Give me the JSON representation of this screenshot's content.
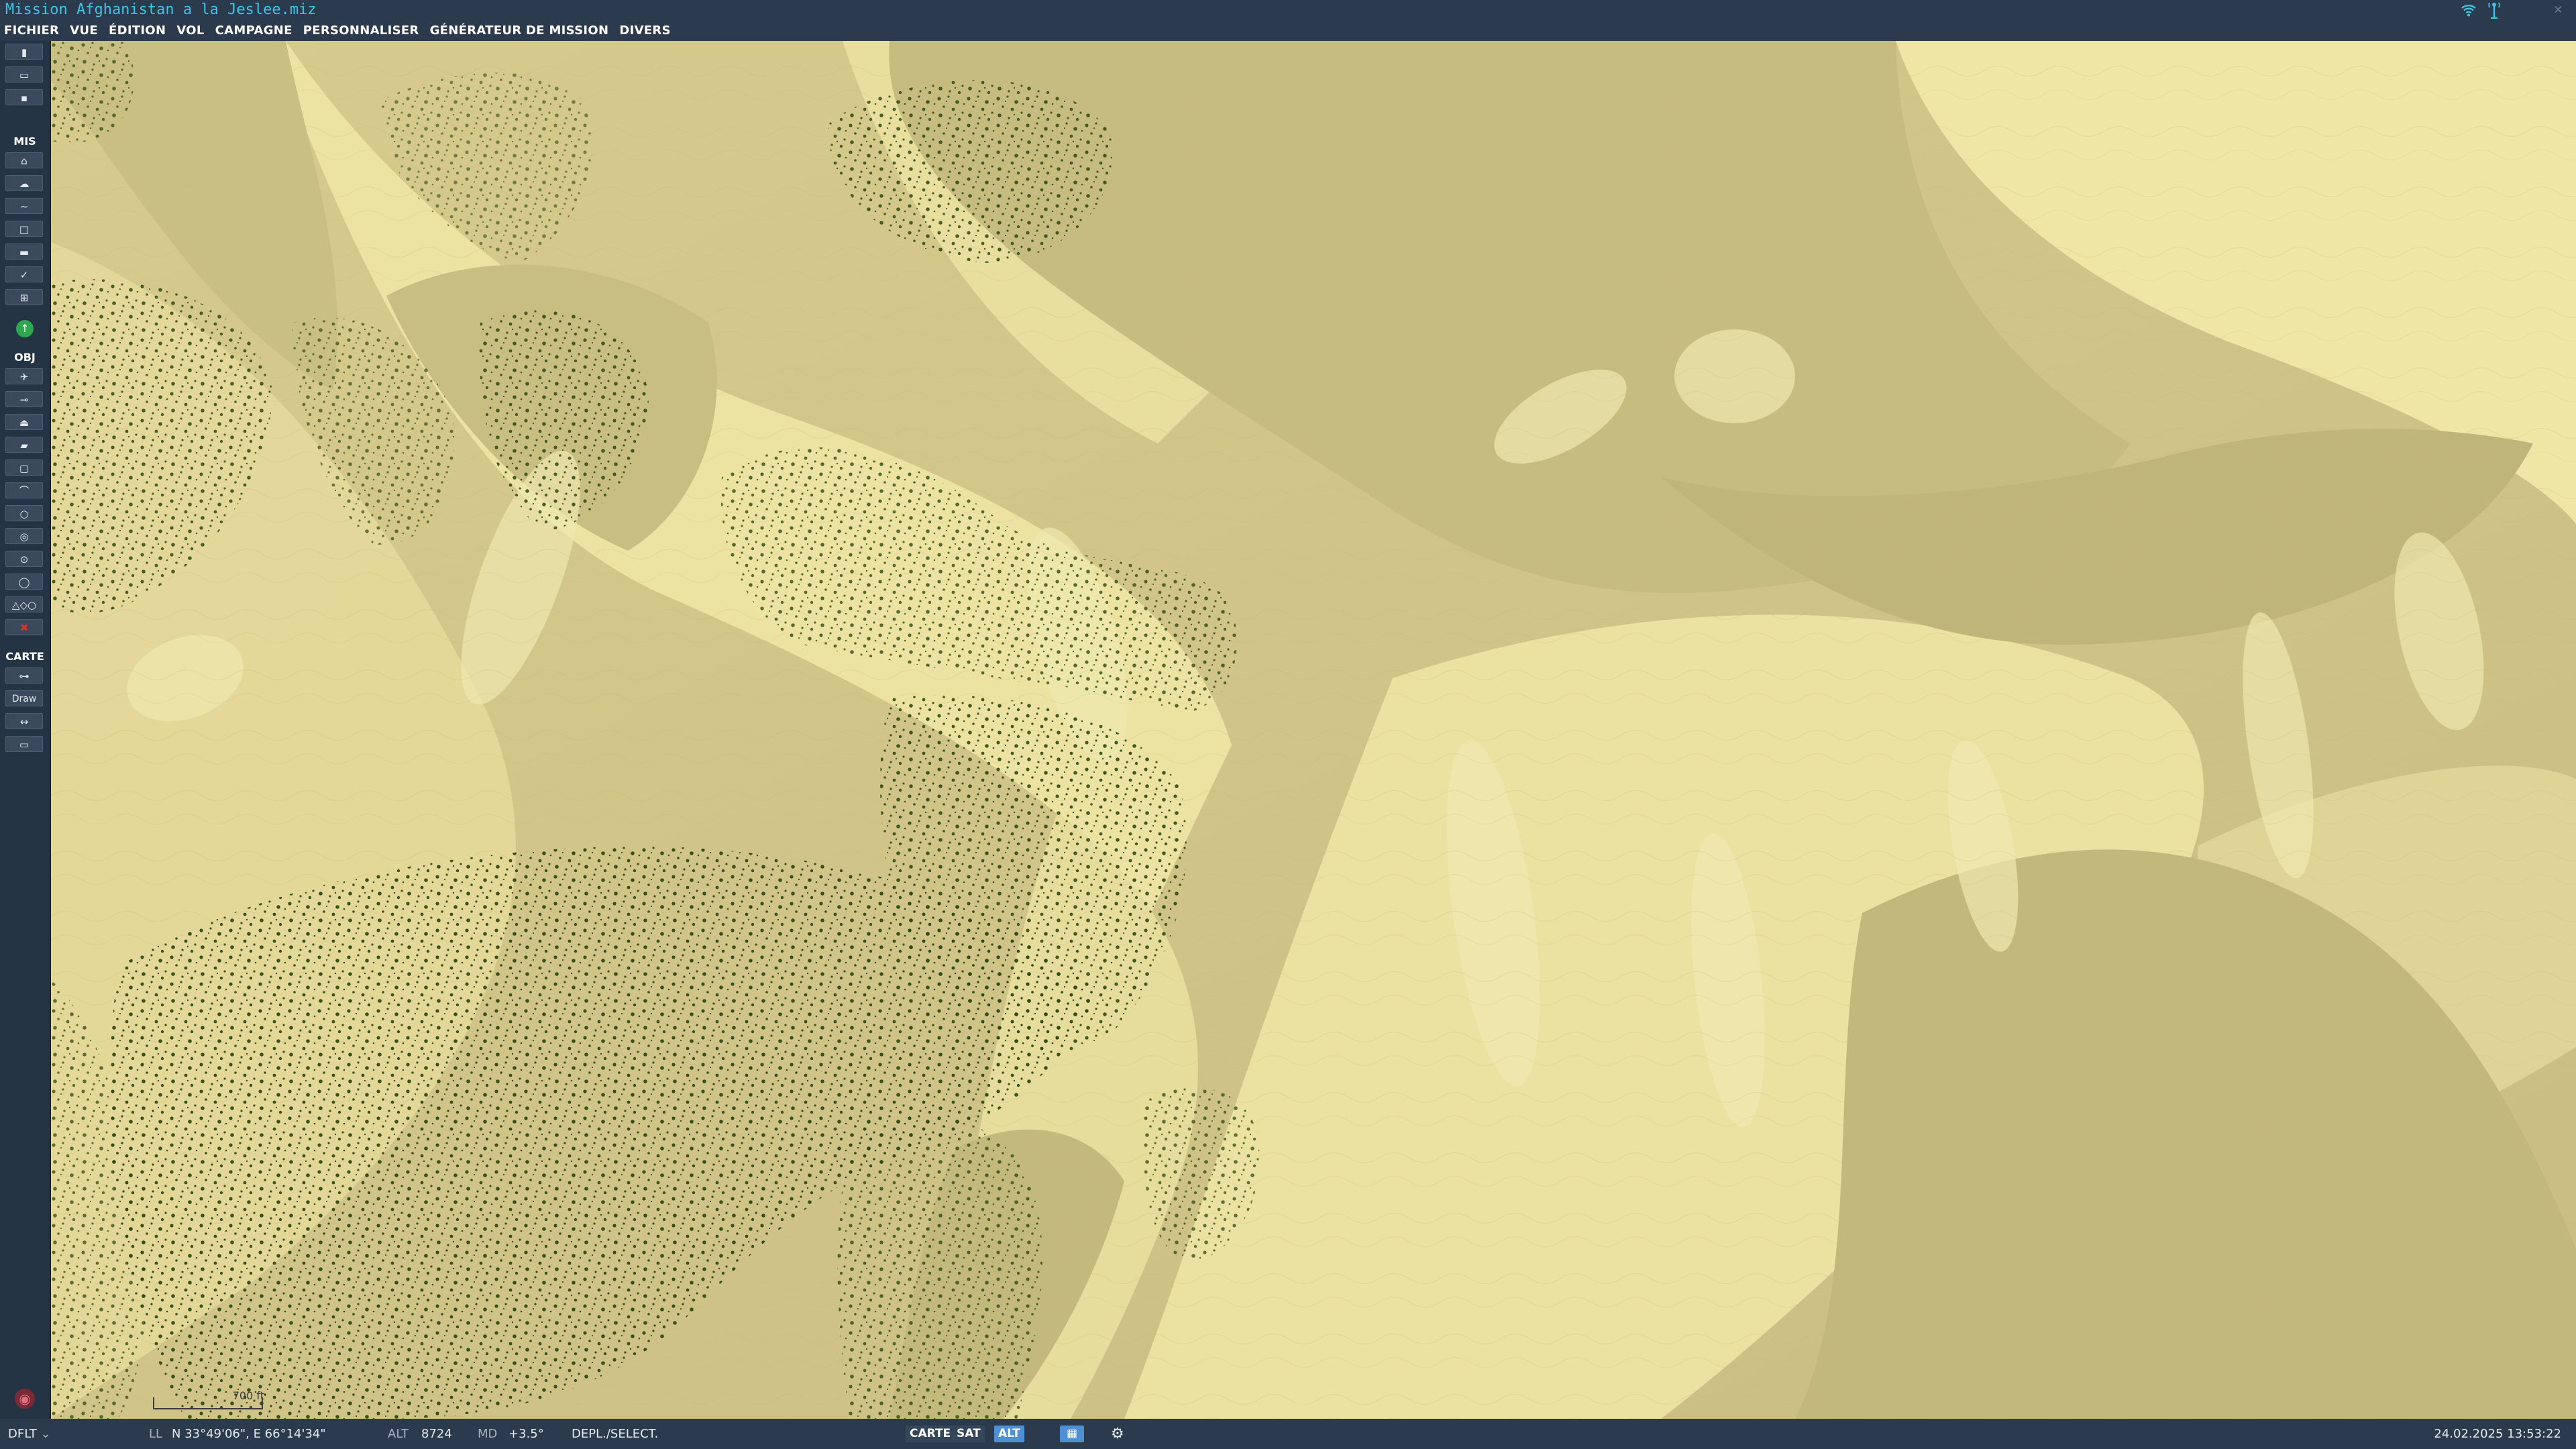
{
  "window": {
    "title": "Mission Afghanistan a la Jeslee.miz",
    "wifi_icon": "wifi-icon",
    "antenna_icon": "antenna-icon",
    "close_glyph": "×"
  },
  "menu": [
    "FICHIER",
    "VUE",
    "ÉDITION",
    "VOL",
    "CAMPAGNE",
    "PERSONNALISER",
    "GÉNÉRATEUR DE MISSION",
    "DIVERS"
  ],
  "toolbar": {
    "file_buttons": [
      "new-file-icon",
      "open-folder-icon",
      "save-icon"
    ],
    "section_mis": "MIS",
    "mis_buttons": [
      "briefing-icon",
      "weather-icon",
      "trigger-icon",
      "zone-icon",
      "goals-icon",
      "check-icon",
      "resource-icon"
    ],
    "status_icon": "up-arrow-icon",
    "section_obj": "OBJ",
    "obj_buttons": [
      "plane-icon",
      "helicopter-icon",
      "ship-icon",
      "ground-unit-icon",
      "static-object-icon",
      "structure-icon",
      "airfield-icon",
      "target-icon",
      "radius-icon",
      "group-icon",
      "shapes-icon",
      "delete-icon"
    ],
    "section_carte": "CARTE",
    "carte_buttons": [
      "measure-icon"
    ],
    "draw_label": "Draw",
    "ruler_icon": "ruler-icon",
    "minimap_icon": "minimap-icon"
  },
  "map": {
    "scale_label": "700 ft",
    "colors": {
      "terrain_light": "#ece3a2",
      "terrain_mid": "#d9cd8f",
      "terrain_dark": "#c2b77c",
      "trees": "#2c4a12"
    }
  },
  "status": {
    "mode": "DFLT",
    "coord_label": "LL",
    "coords": "N 33°49'06\", E 66°14'34\"",
    "alt_label": "ALT",
    "alt_value": "8724",
    "md_label": "MD",
    "md_value": "+3.5°",
    "action": "DEPL./SELECT.",
    "view_buttons": [
      "CARTE",
      "SAT",
      "ALT"
    ],
    "active_view": "ALT",
    "datetime": "24.02.2025 13:53:22"
  }
}
